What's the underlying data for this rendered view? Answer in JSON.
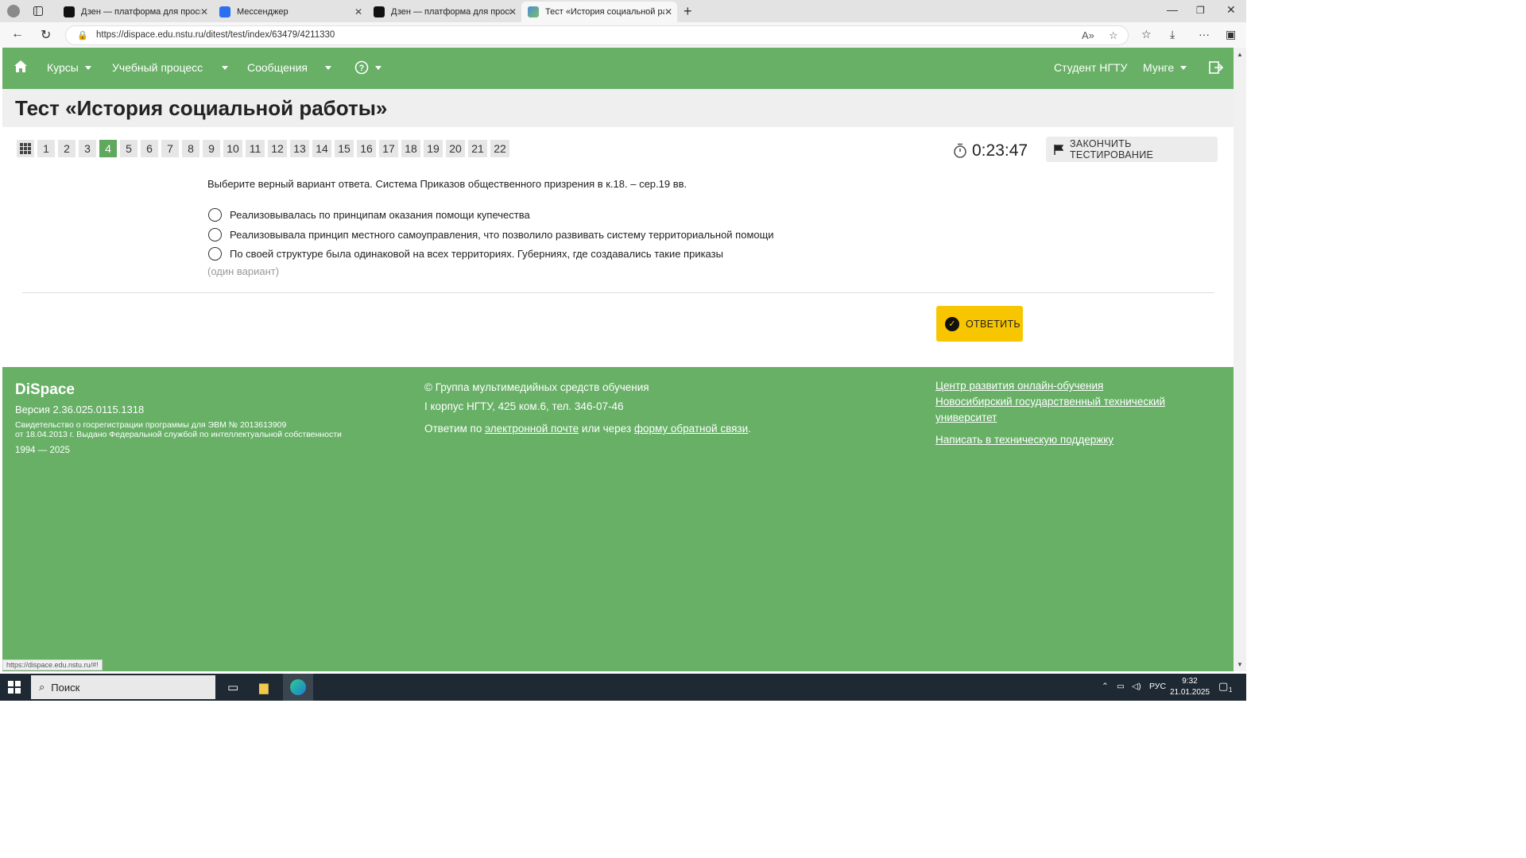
{
  "browser": {
    "tabs": [
      {
        "title": "Дзен — платформа для просмо"
      },
      {
        "title": "Мессенджер"
      },
      {
        "title": "Дзен — платформа для просмо"
      },
      {
        "title": "Тест «История социальной рабо"
      }
    ],
    "url": "https://dispace.edu.nstu.ru/ditest/test/index/63479/4211330",
    "status_url": "https://dispace.edu.nstu.ru/#!"
  },
  "nav": {
    "courses": "Курсы",
    "process": "Учебный процесс",
    "messages": "Сообщения",
    "user_role": "Студент НГТУ",
    "user_name": "Мунге"
  },
  "test": {
    "title": "Тест «История социальной работы»",
    "questions": [
      "1",
      "2",
      "3",
      "4",
      "5",
      "6",
      "7",
      "8",
      "9",
      "10",
      "11",
      "12",
      "13",
      "14",
      "15",
      "16",
      "17",
      "18",
      "19",
      "20",
      "21",
      "22"
    ],
    "current": "4",
    "timer": "0:23:47",
    "finish_label": "ЗАКОНЧИТЬ ТЕСТИРОВАНИЕ",
    "question_text": "Выберите верный вариант ответа. Система Приказов общественного призрения в к.18. – сер.19 вв.",
    "options": [
      "Реализовывалась по принципам оказания помощи купечества",
      "Реализовывала принцип местного самоуправления, что позволило развивать систему территориальной помощи",
      "По своей структуре была одинаковой на всех территориях. Губерниях, где создавались такие приказы"
    ],
    "hint": "(один вариант)",
    "answer_label": "ОТВЕТИТЬ"
  },
  "footer": {
    "brand": "DiSpace",
    "version": "Версия 2.36.025.0115.1318",
    "cert_line1": "Свидетельство о госрегистрации программы для ЭВМ № 2013613909",
    "cert_line2": "от 18.04.2013 г. Выдано Федеральной службой по интеллектуальной собственности",
    "years": "1994 — 2025",
    "group": "© Группа мультимедийных средств обучения",
    "address": "I корпус НГТУ, 425 ком.6, тел. 346-07-46",
    "reply_prefix": "Ответим по",
    "reply_email": "электронной почте",
    "reply_or": "или через",
    "reply_form": "форму обратной связи",
    "reply_end": ".",
    "link_center": "Центр развития онлайн-обучения",
    "link_university": "Новосибирский государственный технический университет",
    "link_support": "Написать в техническую поддержку"
  },
  "taskbar": {
    "search": "Поиск",
    "lang": "РУС",
    "time": "9:32",
    "date": "21.01.2025",
    "notif": "1"
  },
  "colors": {
    "green": "#67b066",
    "current_q": "#5fa85e",
    "answer": "#f8c600"
  }
}
